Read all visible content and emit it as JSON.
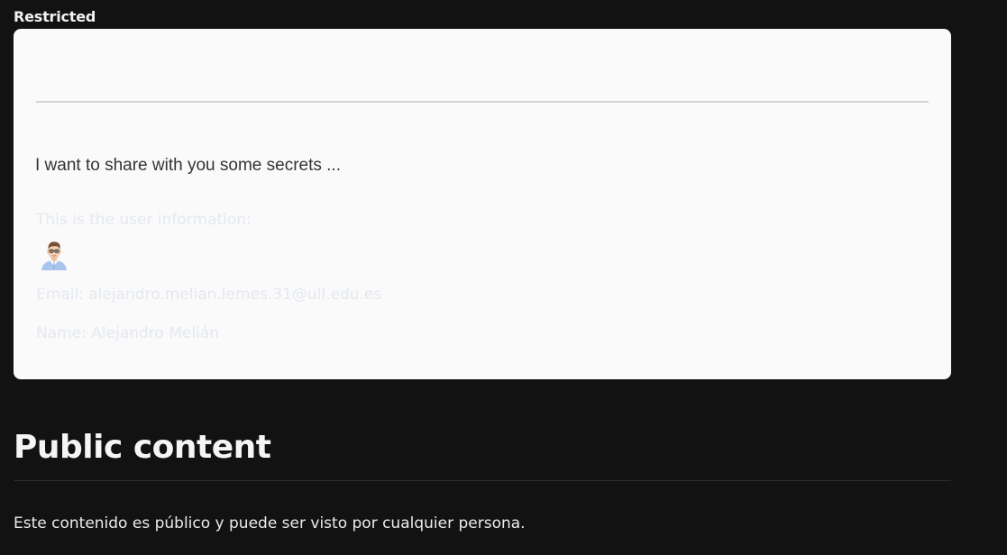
{
  "restricted": {
    "label": "Restricted",
    "share_text": "I want to share with you some secrets ...",
    "user_info_title": "This is the user information:",
    "avatar_icon": "user-avatar-icon",
    "email_line": "Email: alejandro.melian.lemes.31@ull.edu.es",
    "name_line": "Name: Alejandro Melián"
  },
  "public": {
    "title": "Public content",
    "text": "Este contenido es público y puede ser visto por cualquier persona."
  },
  "colors": {
    "page_background": "#121212",
    "card_background": "#fafafa",
    "faded_text": "#e4e8f1"
  }
}
